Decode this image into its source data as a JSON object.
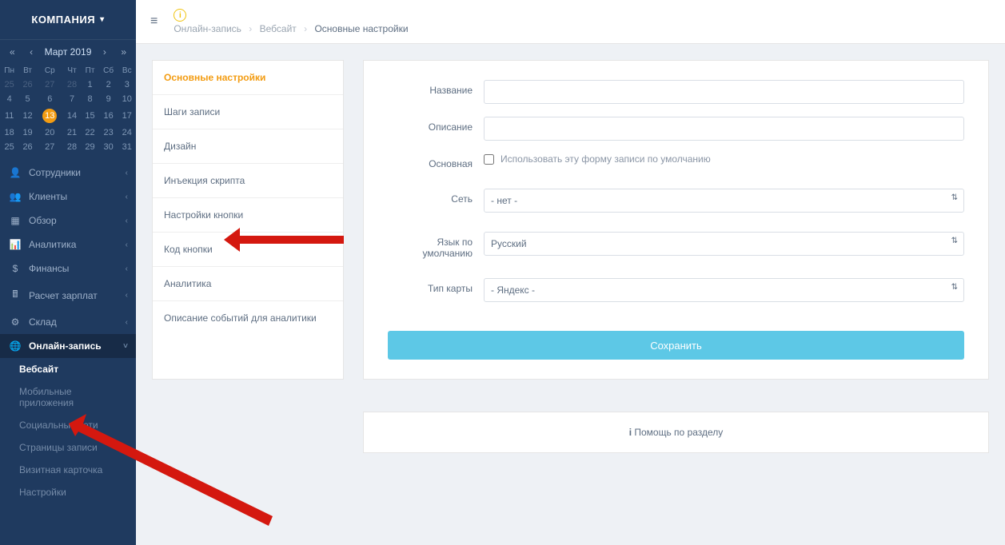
{
  "company": {
    "label": "КОМПАНИЯ"
  },
  "calendar": {
    "month": "Март 2019",
    "days": [
      "Пн",
      "Вт",
      "Ср",
      "Чт",
      "Пт",
      "Сб",
      "Вс"
    ],
    "rows": [
      [
        {
          "d": "25",
          "dim": true
        },
        {
          "d": "26",
          "dim": true
        },
        {
          "d": "27",
          "dim": true
        },
        {
          "d": "28",
          "dim": true
        },
        {
          "d": "1"
        },
        {
          "d": "2"
        },
        {
          "d": "3"
        }
      ],
      [
        {
          "d": "4"
        },
        {
          "d": "5"
        },
        {
          "d": "6"
        },
        {
          "d": "7"
        },
        {
          "d": "8"
        },
        {
          "d": "9"
        },
        {
          "d": "10"
        }
      ],
      [
        {
          "d": "11"
        },
        {
          "d": "12"
        },
        {
          "d": "13",
          "today": true
        },
        {
          "d": "14"
        },
        {
          "d": "15"
        },
        {
          "d": "16"
        },
        {
          "d": "17"
        }
      ],
      [
        {
          "d": "18"
        },
        {
          "d": "19"
        },
        {
          "d": "20"
        },
        {
          "d": "21"
        },
        {
          "d": "22"
        },
        {
          "d": "23"
        },
        {
          "d": "24"
        }
      ],
      [
        {
          "d": "25"
        },
        {
          "d": "26"
        },
        {
          "d": "27"
        },
        {
          "d": "28"
        },
        {
          "d": "29"
        },
        {
          "d": "30"
        },
        {
          "d": "31"
        }
      ]
    ]
  },
  "nav": {
    "items": [
      {
        "icon": "👤",
        "label": "Сотрудники"
      },
      {
        "icon": "👥",
        "label": "Клиенты"
      },
      {
        "icon": "▦",
        "label": "Обзор"
      },
      {
        "icon": "📊",
        "label": "Аналитика"
      },
      {
        "icon": "$",
        "label": "Финансы"
      },
      {
        "icon": "🖩",
        "label": "Расчет зарплат"
      },
      {
        "icon": "⚙",
        "label": "Склад"
      },
      {
        "icon": "🌐",
        "label": "Онлайн-запись"
      }
    ],
    "sub": [
      {
        "label": "Вебсайт",
        "active": true
      },
      {
        "label": "Мобильные приложения"
      },
      {
        "label": "Социальные сети"
      },
      {
        "label": "Страницы записи"
      },
      {
        "label": "Визитная карточка"
      },
      {
        "label": "Настройки"
      }
    ]
  },
  "breadcrumb": {
    "a": "Онлайн-запись",
    "b": "Вебсайт",
    "c": "Основные настройки"
  },
  "tabs": [
    "Основные настройки",
    "Шаги записи",
    "Дизайн",
    "Инъекция скрипта",
    "Настройки кнопки",
    "Код кнопки",
    "Аналитика",
    "Описание событий для аналитики"
  ],
  "form": {
    "name_label": "Название",
    "desc_label": "Описание",
    "main_label": "Основная",
    "main_check": "Использовать эту форму записи по умолчанию",
    "net_label": "Сеть",
    "net_value": "- нет -",
    "lang_label": "Язык по умолчанию",
    "lang_value": "Русский",
    "map_label": "Тип карты",
    "map_value": "- Яндекс -",
    "save": "Сохранить"
  },
  "help": {
    "text": "Помощь по разделу"
  }
}
